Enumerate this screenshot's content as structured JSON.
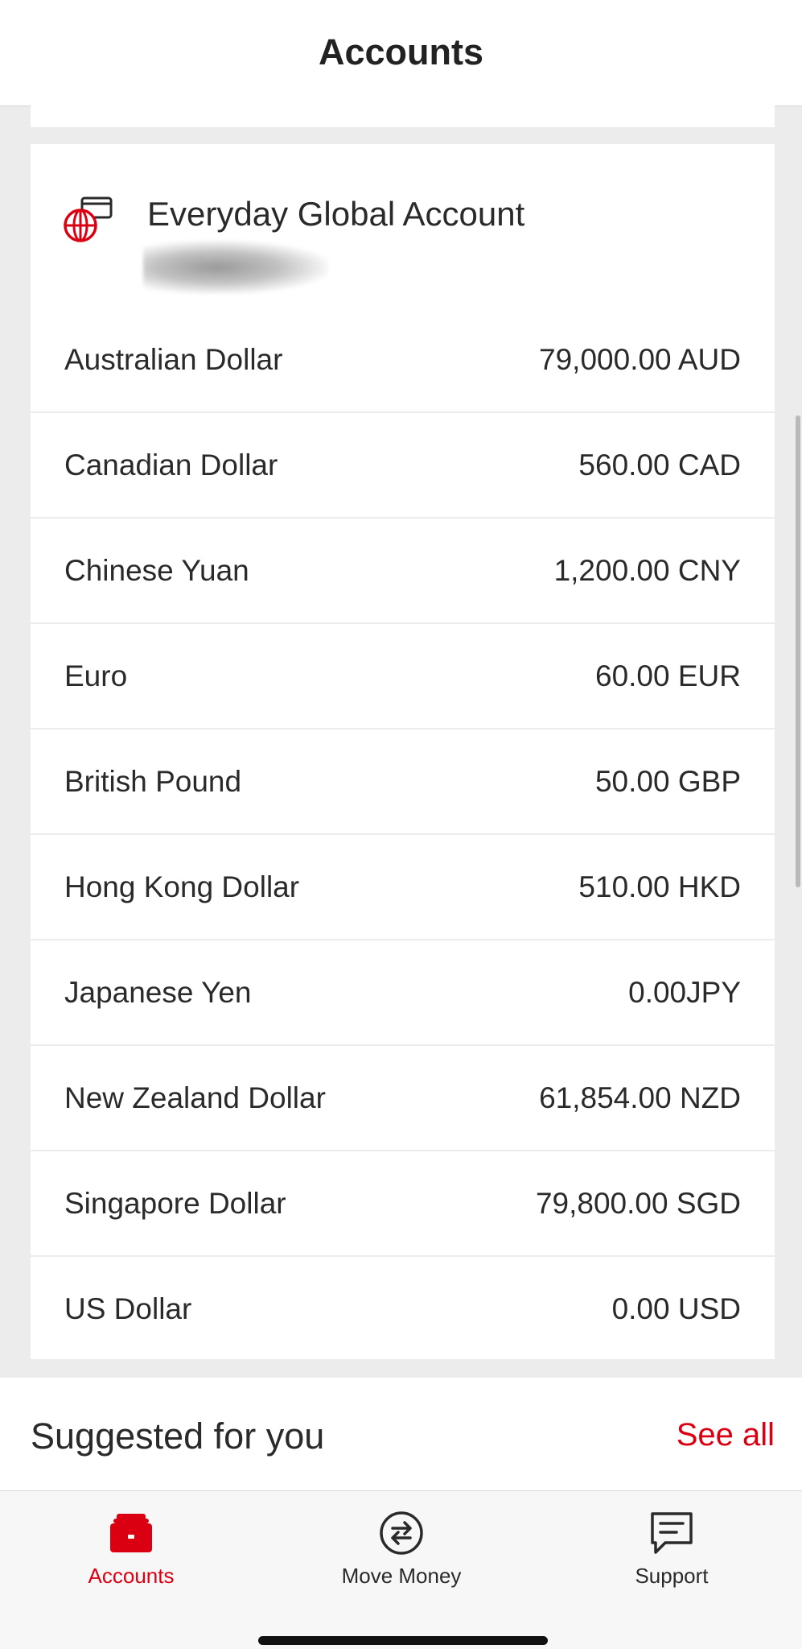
{
  "header": {
    "title": "Accounts"
  },
  "account": {
    "name": "Everyday Global Account",
    "number": "",
    "balances": [
      {
        "currency": "Australian Dollar",
        "amount": "79,000.00 AUD"
      },
      {
        "currency": "Canadian Dollar",
        "amount": "560.00 CAD"
      },
      {
        "currency": "Chinese Yuan",
        "amount": "1,200.00 CNY"
      },
      {
        "currency": "Euro",
        "amount": "60.00 EUR"
      },
      {
        "currency": "British Pound",
        "amount": "50.00 GBP"
      },
      {
        "currency": "Hong Kong Dollar",
        "amount": "510.00 HKD"
      },
      {
        "currency": "Japanese Yen",
        "amount": "0.00JPY"
      },
      {
        "currency": "New Zealand Dollar",
        "amount": "61,854.00 NZD"
      },
      {
        "currency": "Singapore Dollar",
        "amount": "79,800.00 SGD"
      },
      {
        "currency": "US Dollar",
        "amount": "0.00 USD"
      }
    ]
  },
  "suggested": {
    "heading": "Suggested for you",
    "see_all": "See all"
  },
  "tabbar": {
    "tabs": [
      {
        "label": "Accounts",
        "icon": "wallet-icon",
        "active": true
      },
      {
        "label": "Move Money",
        "icon": "transfer-icon",
        "active": false
      },
      {
        "label": "Support",
        "icon": "chat-icon",
        "active": false
      }
    ]
  },
  "colors": {
    "accent": "#db0011",
    "background": "#ececec",
    "card": "#ffffff",
    "text": "#2a2a2a"
  }
}
